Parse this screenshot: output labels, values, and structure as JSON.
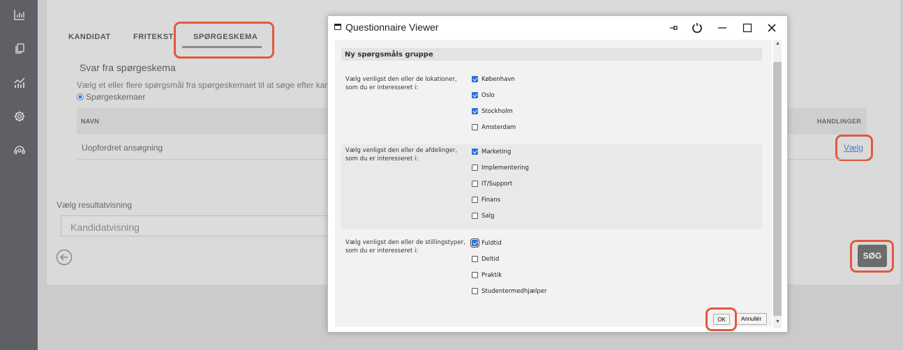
{
  "sidebar": {
    "icons": [
      "bar-chart-icon",
      "copy-icon",
      "analytics-icon",
      "gear-icon",
      "support-icon"
    ]
  },
  "tabs": [
    {
      "label": "KANDIDAT"
    },
    {
      "label": "FRITEKST"
    },
    {
      "label": "SPØRGESKEMA"
    }
  ],
  "section": {
    "title": "Svar fra spørgeskema",
    "description": "Vælg et eller flere spørgsmål fra spørgeskemaet til at søge efter kar",
    "radio_label": "Spørgeskemaer"
  },
  "table": {
    "headers": {
      "name": "NAVN",
      "actions": "HANDLINGER"
    },
    "rows": [
      {
        "name": "Uopfordret ansøgning",
        "action": "Vælg"
      }
    ]
  },
  "result_view": {
    "label": "Vælg resultatvisning",
    "value": "Kandidatvisning"
  },
  "search_button": "SØG",
  "dialog": {
    "title": "Questionnaire Viewer",
    "group_title": "Ny spørgsmåls gruppe",
    "questions": [
      {
        "text": "Vælg venligst den eller de lokationer, som du er interesseret i:",
        "options": [
          {
            "label": "København",
            "checked": true
          },
          {
            "label": "Oslo",
            "checked": true
          },
          {
            "label": "Stockholm",
            "checked": true
          },
          {
            "label": "Amsterdam",
            "checked": false
          }
        ]
      },
      {
        "text": "Vælg venligst den eller de afdelinger, som du er interesseret i:",
        "options": [
          {
            "label": "Marketing",
            "checked": true
          },
          {
            "label": "Implementering",
            "checked": false
          },
          {
            "label": "IT/Support",
            "checked": false
          },
          {
            "label": "Finans",
            "checked": false
          },
          {
            "label": "Salg",
            "checked": false
          }
        ]
      },
      {
        "text": "Vælg venligst den eller de stillingstyper, som du er interesseret i:",
        "options": [
          {
            "label": "Fuldtid",
            "checked": true
          },
          {
            "label": "Deltid",
            "checked": false
          },
          {
            "label": "Praktik",
            "checked": false
          },
          {
            "label": "Studentermedhjælper",
            "checked": false
          }
        ]
      }
    ],
    "ok_label": "OK",
    "cancel_label": "Annullér"
  },
  "colors": {
    "highlight": "#e05a3c",
    "checkbox": "#2f6fd6",
    "sidebar": "#5f5f66",
    "link": "#4a7fc0"
  }
}
